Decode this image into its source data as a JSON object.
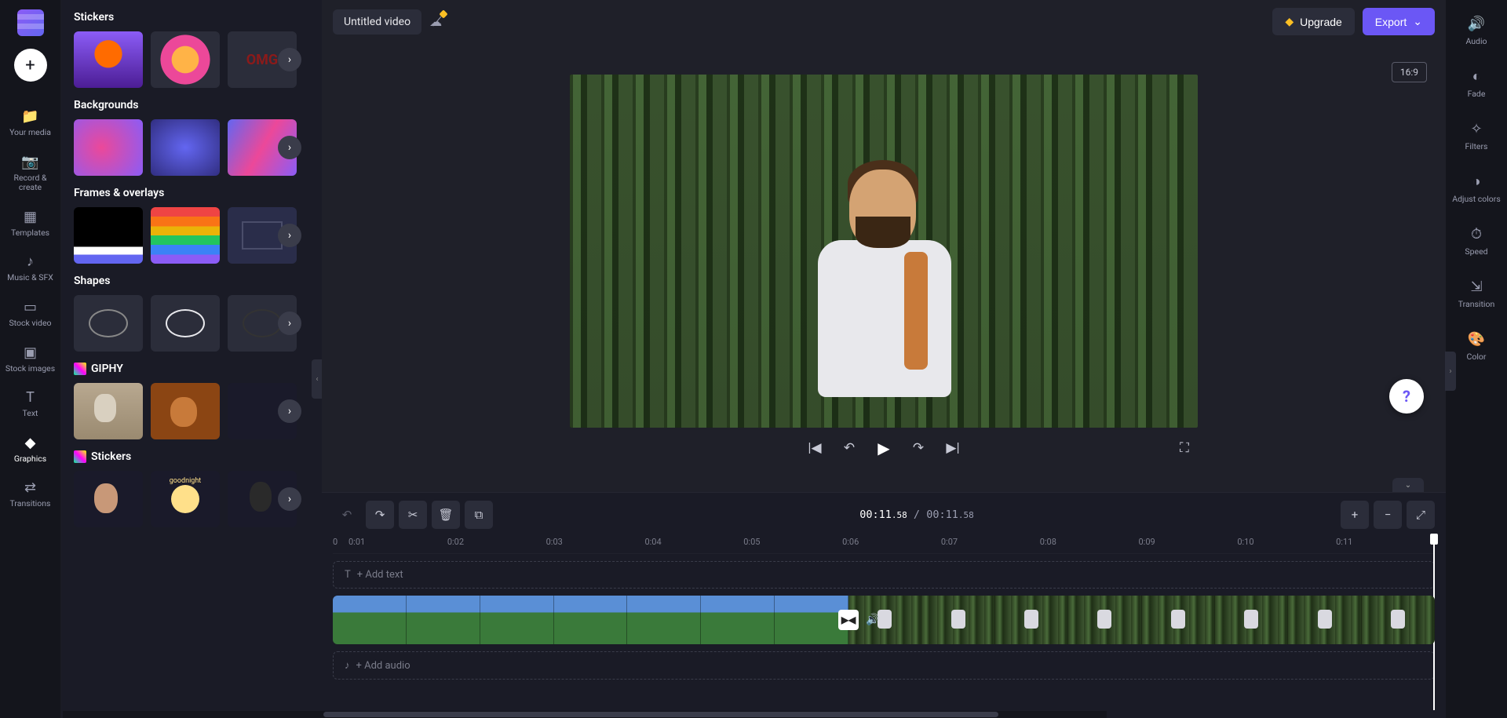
{
  "rail": {
    "items": [
      {
        "icon": "📁",
        "label": "Your media"
      },
      {
        "icon": "📷",
        "label": "Record & create"
      },
      {
        "icon": "▦",
        "label": "Templates"
      },
      {
        "icon": "♪",
        "label": "Music & SFX"
      },
      {
        "icon": "▭",
        "label": "Stock video"
      },
      {
        "icon": "▣",
        "label": "Stock images"
      },
      {
        "icon": "T",
        "label": "Text"
      },
      {
        "icon": "◆",
        "label": "Graphics"
      },
      {
        "icon": "⇄",
        "label": "Transitions"
      }
    ]
  },
  "assets": {
    "sections": [
      {
        "title": "Stickers"
      },
      {
        "title": "Backgrounds"
      },
      {
        "title": "Frames & overlays"
      },
      {
        "title": "Shapes"
      },
      {
        "title": "GIPHY"
      },
      {
        "title": "Stickers"
      }
    ],
    "omg": "OMG"
  },
  "topbar": {
    "title": "Untitled video",
    "upgrade": "Upgrade",
    "export": "Export"
  },
  "preview": {
    "aspect": "16:9"
  },
  "timeline": {
    "time_current": "00:11",
    "time_current_ms": ".58",
    "time_sep": " / ",
    "time_total": "00:11",
    "time_total_ms": ".58",
    "ruler": [
      "0",
      "0:01",
      "0:02",
      "0:03",
      "0:04",
      "0:05",
      "0:06",
      "0:07",
      "0:08",
      "0:09",
      "0:10",
      "0:11"
    ],
    "add_text": "+ Add text",
    "add_audio": "+ Add audio"
  },
  "right_rail": {
    "items": [
      {
        "icon": "🔊",
        "label": "Audio"
      },
      {
        "icon": "◐",
        "label": "Fade"
      },
      {
        "icon": "✧",
        "label": "Filters"
      },
      {
        "icon": "◑",
        "label": "Adjust colors"
      },
      {
        "icon": "⏱",
        "label": "Speed"
      },
      {
        "icon": "⇲",
        "label": "Transition"
      },
      {
        "icon": "🎨",
        "label": "Color"
      }
    ]
  }
}
